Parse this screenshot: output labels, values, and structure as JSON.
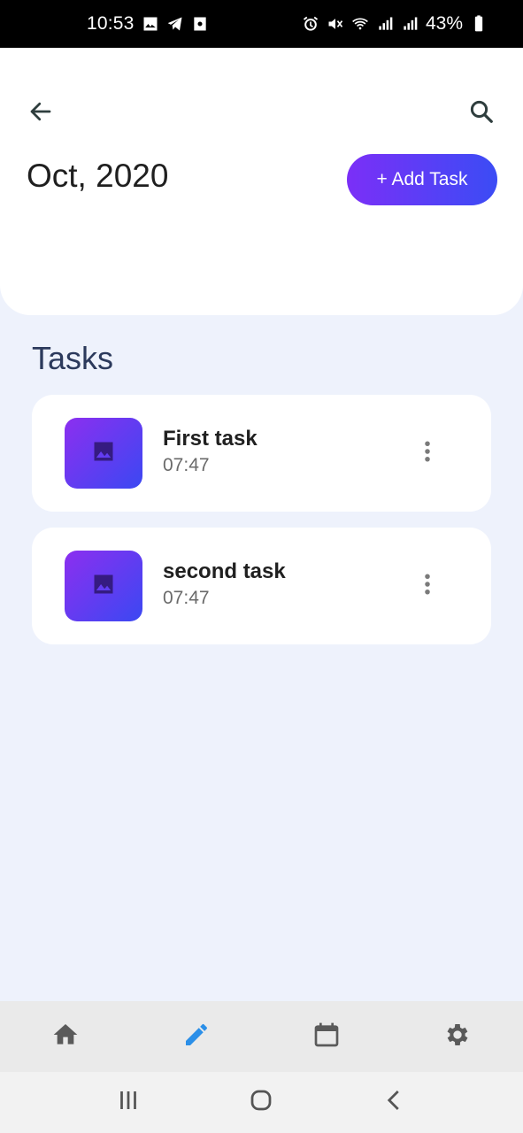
{
  "status_bar": {
    "time": "10:53",
    "battery": "43%",
    "left_icons": [
      "image-icon",
      "telegram-icon",
      "camera-app-icon"
    ],
    "right_icons": [
      "alarm-icon",
      "mute-icon",
      "wifi-icon",
      "signal-icon",
      "signal-icon",
      "battery-icon"
    ]
  },
  "header": {
    "back_icon": "arrow-left-icon",
    "search_icon": "search-icon",
    "month_title": "Oct, 2020",
    "add_task_label": "+ Add Task"
  },
  "tasks_section": {
    "title": "Tasks",
    "items": [
      {
        "name": "First task",
        "time": "07:47",
        "thumb_icon": "image-icon",
        "menu_icon": "more-vertical-icon"
      },
      {
        "name": "second task",
        "time": "07:47",
        "thumb_icon": "image-icon",
        "menu_icon": "more-vertical-icon"
      }
    ]
  },
  "bottom_nav": {
    "items": [
      {
        "icon": "home-icon",
        "active": false
      },
      {
        "icon": "edit-icon",
        "active": true
      },
      {
        "icon": "calendar-icon",
        "active": false
      },
      {
        "icon": "settings-icon",
        "active": false
      }
    ],
    "active_color": "#2b8fe8",
    "inactive_color": "#5a5a5a"
  },
  "android_nav": [
    "recent-apps-icon",
    "home-circle-icon",
    "back-chevron-icon"
  ],
  "colors": {
    "accent_start": "#7b2ff7",
    "accent_end": "#3b4cf5",
    "background": "#eef2fc",
    "section_title": "#2c3a5c"
  }
}
